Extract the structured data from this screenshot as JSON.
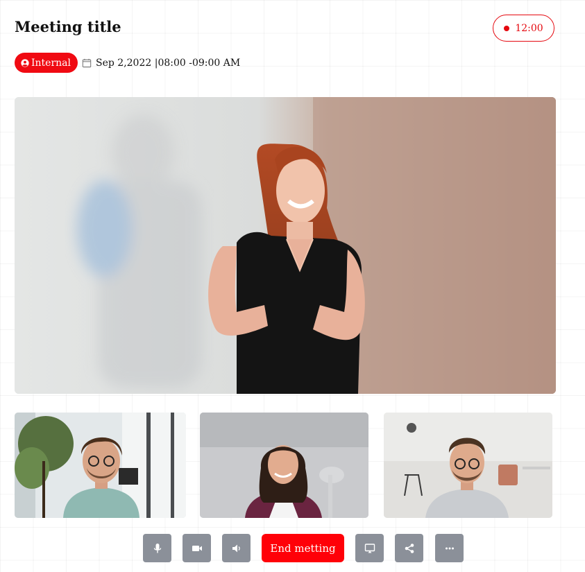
{
  "meeting": {
    "title": "Meeting title",
    "timer": "12:00",
    "badge": "Internal",
    "date": "Sep 2,2022 |08:00 -09:00 AM"
  },
  "controls": {
    "end_label": "End metting",
    "buttons": [
      "microphone-icon",
      "camera-icon",
      "speaker-icon",
      "end-button",
      "screen-share-icon",
      "share-icon",
      "more-icon"
    ]
  },
  "participants": {
    "main": "speaker-video",
    "thumbnails": [
      "participant-1",
      "participant-2",
      "participant-3"
    ]
  },
  "colors": {
    "accent": "#ff0008",
    "control_bg": "#8b9099",
    "recording": "#e5080f"
  }
}
